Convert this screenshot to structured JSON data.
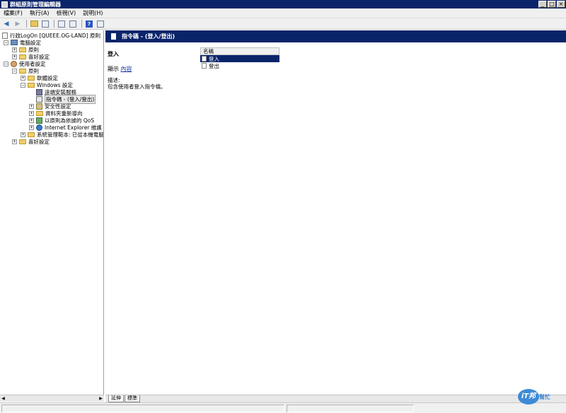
{
  "window": {
    "title": "群組原則管理編輯器"
  },
  "menu": [
    "檔案(F)",
    "執行(A)",
    "檢視(V)",
    "說明(H)"
  ],
  "tree": {
    "items": [
      {
        "label": "行政LogOn [QUEEE.OG-LAND] 原則",
        "icon": "policy-doc-icon"
      },
      {
        "label": "電腦設定",
        "icon": "computer-icon"
      },
      {
        "label": "原則",
        "icon": "folder-icon"
      },
      {
        "label": "喜好設定",
        "icon": "folder-icon"
      },
      {
        "label": "使用者設定",
        "icon": "user-icon"
      },
      {
        "label": "原則",
        "icon": "folder-icon"
      },
      {
        "label": "軟體設定",
        "icon": "folder-icon"
      },
      {
        "label": "Windows 設定",
        "icon": "folder-icon"
      },
      {
        "label": "遠端安裝服務",
        "icon": "remote-icon"
      },
      {
        "label": "指令碼 - (登入/登出)",
        "icon": "script-icon"
      },
      {
        "label": "安全性設定",
        "icon": "shield-icon"
      },
      {
        "label": "資料夾重新導向",
        "icon": "folder-icon"
      },
      {
        "label": "以原則為依據的 QoS",
        "icon": "chart-icon"
      },
      {
        "label": "Internet Explorer 維護",
        "icon": "ie-icon"
      },
      {
        "label": "系統管理範本: 已從本機電腦",
        "icon": "folder-icon"
      },
      {
        "label": "喜好設定",
        "icon": "folder-icon"
      }
    ]
  },
  "right": {
    "header": "指令碼 - (登入/登出)",
    "desc_title": "登入",
    "show_prefix": "顯示",
    "show_link": "內容",
    "desc_label": "描述:",
    "desc_text": "包含使用者登入指令檔。",
    "list_header": "名稱",
    "list_items": [
      "登入",
      "登出"
    ]
  },
  "tabs": [
    "延伸",
    "標準"
  ],
  "watermark": {
    "badge": "iT邦",
    "text": "幫忙"
  }
}
